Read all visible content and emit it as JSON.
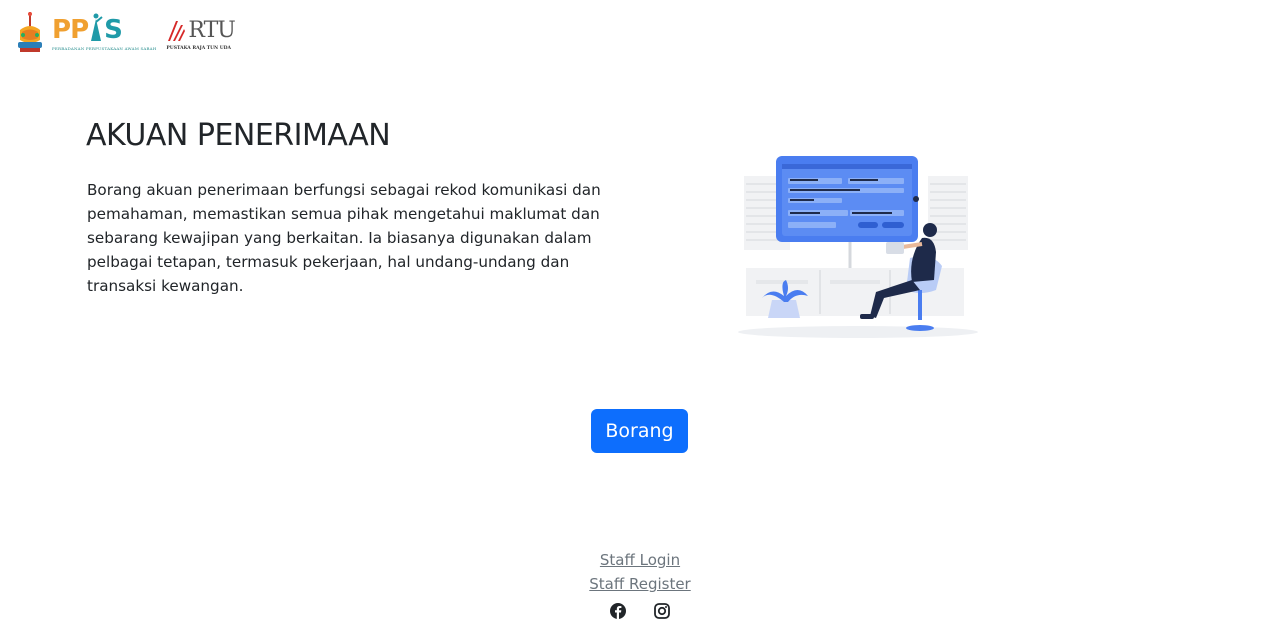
{
  "header": {
    "ppas_logo_text": "PPAS",
    "ppas_logo_sub": "PERBADANAN PERPUSTAKAAN AWAM SABAH",
    "rtu_logo_text": "RTU",
    "rtu_logo_sub": "PUSTAKA RAJA TUN UDA"
  },
  "hero": {
    "title": "AKUAN PENERIMAAN",
    "description": "Borang akuan penerimaan berfungsi sebagai rekod komunikasi dan pemahaman, memastikan semua pihak mengetahui maklumat dan sebarang kewajipan yang berkaitan. Ia biasanya digunakan dalam pelbagai tetapan, termasuk pekerjaan, hal undang-undang dan transaksi kewangan."
  },
  "actions": {
    "form_button_label": "Borang"
  },
  "footer": {
    "staff_login": "Staff Login",
    "staff_register": "Staff Register",
    "social_icons": [
      "facebook-icon",
      "instagram-icon"
    ]
  },
  "colors": {
    "primary": "#0d6efd",
    "illustration_blue": "#4a7df0",
    "link_gray": "#6c757d"
  }
}
